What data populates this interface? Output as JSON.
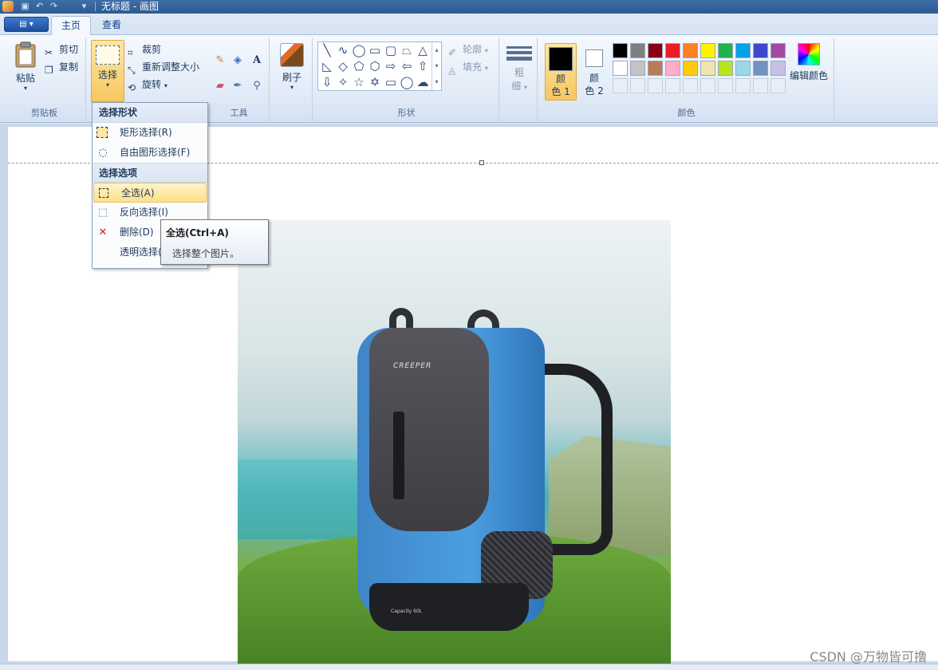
{
  "window": {
    "title": "无标题 - 画图"
  },
  "tabs": [
    {
      "label": "主页"
    },
    {
      "label": "查看"
    }
  ],
  "clipboard": {
    "paste_label": "粘贴",
    "cut_label": "剪切",
    "copy_label": "复制",
    "group_label": "剪贴板"
  },
  "image": {
    "select_label": "选择",
    "crop_label": "裁剪",
    "resize_label": "重新调整大小",
    "rotate_label": "旋转"
  },
  "tools": {
    "group_label": "工具",
    "text_glyph": "A"
  },
  "brush": {
    "label": "刷子"
  },
  "shapes": {
    "group_label": "形状",
    "outline_label": "轮廓",
    "fill_label": "填充"
  },
  "size": {
    "label_line1": "粗",
    "label_line2": "细"
  },
  "colors": {
    "group_label": "颜色",
    "color1_line1": "颜",
    "color1_line2": "色 1",
    "color2_line1": "颜",
    "color2_line2": "色 2",
    "edit_label": "编辑颜色",
    "color1_value": "#000000",
    "color2_value": "#ffffff",
    "palette_row1": [
      "#000000",
      "#7f7f7f",
      "#880015",
      "#ed1c24",
      "#ff7f27",
      "#fff200",
      "#22b14c",
      "#00a2e8",
      "#3f48cc",
      "#a349a4"
    ],
    "palette_row2": [
      "#ffffff",
      "#c3c3c3",
      "#b97a57",
      "#ffaec9",
      "#ffc90e",
      "#efe4b0",
      "#b5e61d",
      "#99d9ea",
      "#7092be",
      "#c8bfe7"
    ]
  },
  "dropdown": {
    "header_shape": "选择形状",
    "rect_select": "矩形选择(R)",
    "free_select": "自由图形选择(F)",
    "header_options": "选择选项",
    "select_all": "全选(A)",
    "invert_select": "反向选择(I)",
    "delete": "删除(D)",
    "transparent_select": "透明选择(T)"
  },
  "tooltip": {
    "title": "全选(Ctrl+A)",
    "description": "选择整个图片。"
  },
  "canvas_image": {
    "brand_text": "CREEPER",
    "capacity_text": "Capacity 60L"
  },
  "watermark": "CSDN @万物皆可撸"
}
